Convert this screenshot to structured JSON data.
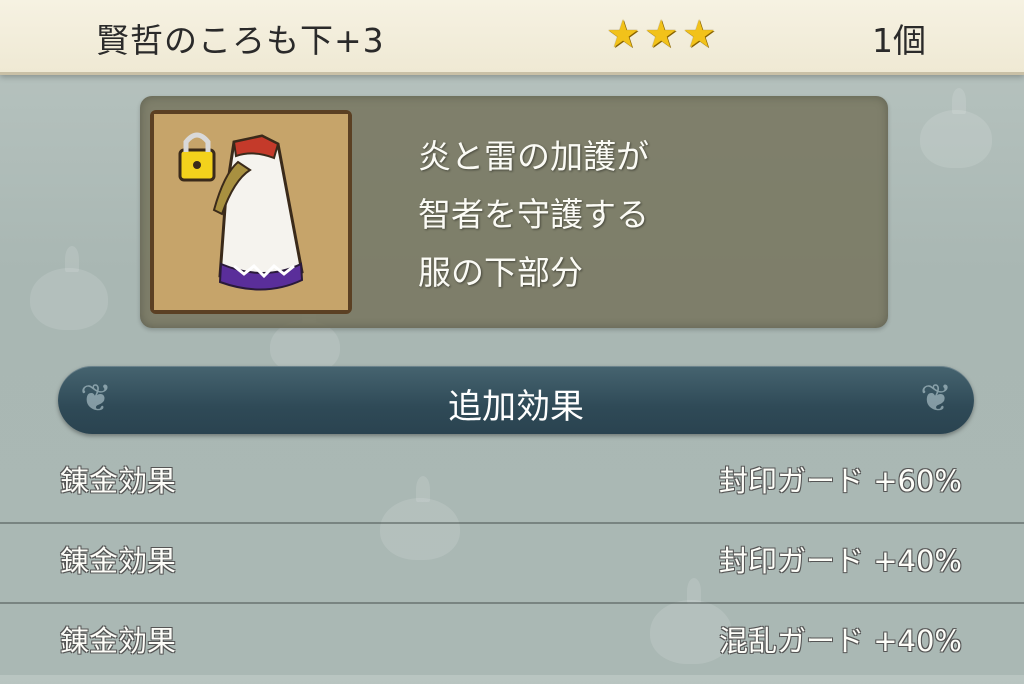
{
  "header": {
    "item_name": "賢哲のころも下+3",
    "star_count": 3,
    "star_color": "#f2c21a",
    "quantity": "1個"
  },
  "item": {
    "icon": "robe-bottom-icon",
    "locked": true,
    "description_lines": [
      "炎と雷の加護が",
      "智者を守護する",
      "服の下部分"
    ]
  },
  "section": {
    "title": "追加効果"
  },
  "effects": [
    {
      "label": "錬金効果",
      "value": "封印ガード +60%"
    },
    {
      "label": "錬金効果",
      "value": "封印ガード +40%"
    },
    {
      "label": "錬金効果",
      "value": "混乱ガード +40%"
    }
  ]
}
